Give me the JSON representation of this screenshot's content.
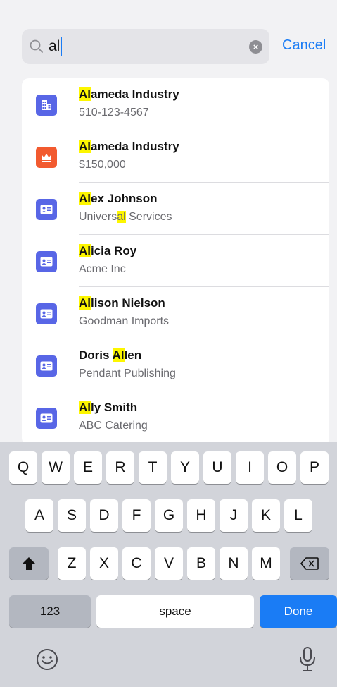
{
  "search": {
    "query": "al",
    "clear_glyph": "×",
    "cancel_label": "Cancel"
  },
  "results": [
    {
      "icon": "building-icon",
      "icon_color": "#5866e6",
      "title_hl": "Al",
      "title_rest": "ameda Industry",
      "sub_pre": "510-123-4567",
      "sub_hl": "",
      "sub_post": ""
    },
    {
      "icon": "crown-icon",
      "icon_color": "#f25a2f",
      "title_hl": "Al",
      "title_rest": "ameda Industry",
      "sub_pre": "$150,000",
      "sub_hl": "",
      "sub_post": ""
    },
    {
      "icon": "contact-card-icon",
      "icon_color": "#5866e6",
      "title_hl": "Al",
      "title_rest": "ex Johnson",
      "sub_pre": "Univers",
      "sub_hl": "al",
      "sub_post": " Services"
    },
    {
      "icon": "contact-card-icon",
      "icon_color": "#5866e6",
      "title_hl": "Al",
      "title_rest": "icia Roy",
      "sub_pre": "Acme Inc",
      "sub_hl": "",
      "sub_post": ""
    },
    {
      "icon": "contact-card-icon",
      "icon_color": "#5866e6",
      "title_hl": "Al",
      "title_rest": "lison Nielson",
      "sub_pre": "Goodman Imports",
      "sub_hl": "",
      "sub_post": ""
    },
    {
      "icon": "contact-card-icon",
      "icon_color": "#5866e6",
      "title_pre": "Doris ",
      "title_hl": "Al",
      "title_rest": "len",
      "sub_pre": "Pendant Publishing",
      "sub_hl": "",
      "sub_post": ""
    },
    {
      "icon": "contact-card-icon",
      "icon_color": "#5866e6",
      "title_hl": "Al",
      "title_rest": "ly Smith",
      "sub_pre": "ABC Catering",
      "sub_hl": "",
      "sub_post": ""
    }
  ],
  "keyboard": {
    "row1": [
      "Q",
      "W",
      "E",
      "R",
      "T",
      "Y",
      "U",
      "I",
      "O",
      "P"
    ],
    "row2": [
      "A",
      "S",
      "D",
      "F",
      "G",
      "H",
      "J",
      "K",
      "L"
    ],
    "row3": [
      "Z",
      "X",
      "C",
      "V",
      "B",
      "N",
      "M"
    ],
    "numbers_label": "123",
    "space_label": "space",
    "done_label": "Done"
  },
  "colors": {
    "accent": "#1a7cf5",
    "highlight": "#fdf600"
  }
}
